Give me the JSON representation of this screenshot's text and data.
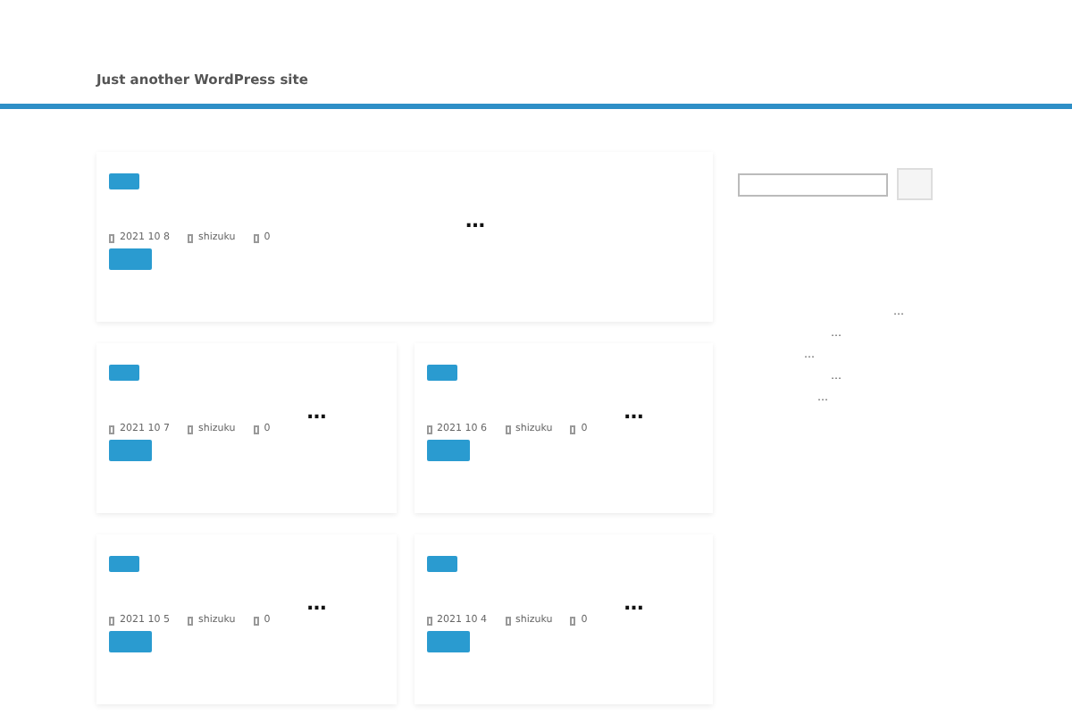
{
  "header": {
    "tagline": "Just another WordPress site"
  },
  "posts": [
    {
      "title": "…",
      "date": "2021  10  8",
      "author": "shizuku",
      "comments": "0",
      "wide": true
    },
    {
      "title": "…",
      "date": "2021  10  7",
      "author": "shizuku",
      "comments": "0",
      "wide": false
    },
    {
      "title": "…",
      "date": "2021  10  6",
      "author": "shizuku",
      "comments": "0",
      "wide": false
    },
    {
      "title": "…",
      "date": "2021  10  5",
      "author": "shizuku",
      "comments": "0",
      "wide": false
    },
    {
      "title": "…",
      "date": "2021  10  4",
      "author": "shizuku",
      "comments": "0",
      "wide": false
    }
  ],
  "sidebar": {
    "recent_posts": [
      "…",
      "…",
      "…",
      "…",
      "…"
    ]
  }
}
